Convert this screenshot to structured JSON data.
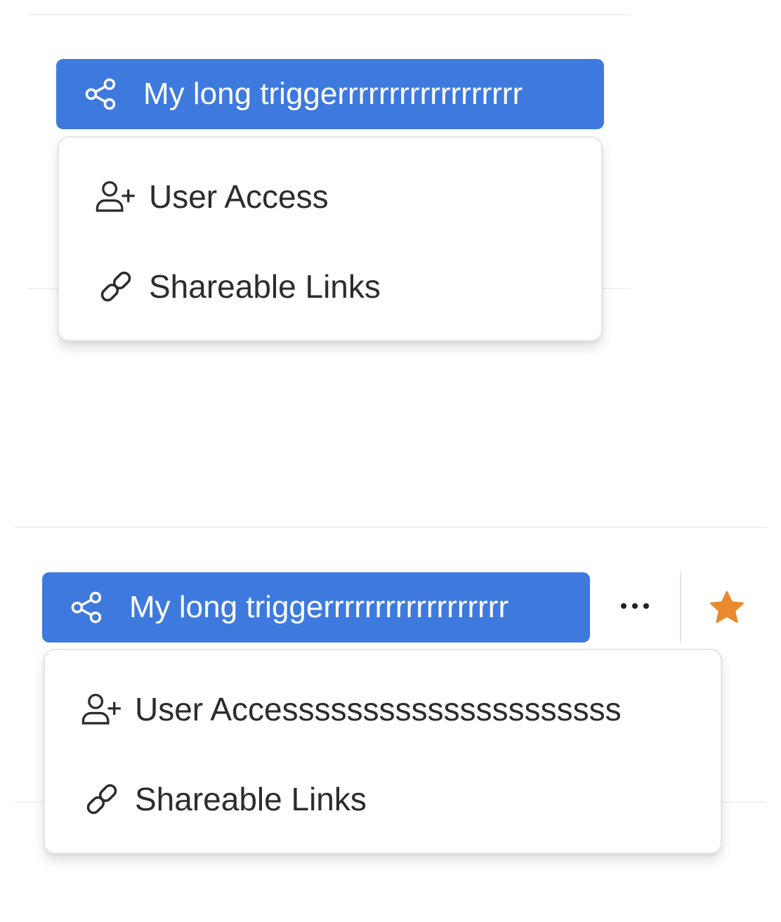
{
  "top_example": {
    "trigger_label": "My long triggerrrrrrrrrrrrrrrrrr",
    "trigger_icon": "share-icon",
    "menu_items": [
      {
        "label": "User Access",
        "icon": "user-plus-icon"
      },
      {
        "label": "Shareable Links",
        "icon": "link-icon"
      }
    ]
  },
  "bottom_example": {
    "trigger_label": "My long triggerrrrrrrrrrrrrrrrrr",
    "trigger_icon": "share-icon",
    "more_icon": "more-horizontal-icon",
    "favorite_icon": "star-icon",
    "menu_items": [
      {
        "label": "User Accesssssssssssssssssssss",
        "icon": "user-plus-icon"
      },
      {
        "label": "Shareable Links",
        "icon": "link-icon"
      }
    ]
  },
  "colors": {
    "trigger_bg": "#3e7ade",
    "trigger_text": "#ffffff",
    "menu_text": "#2c2c2c",
    "star": "#e98a2f"
  }
}
